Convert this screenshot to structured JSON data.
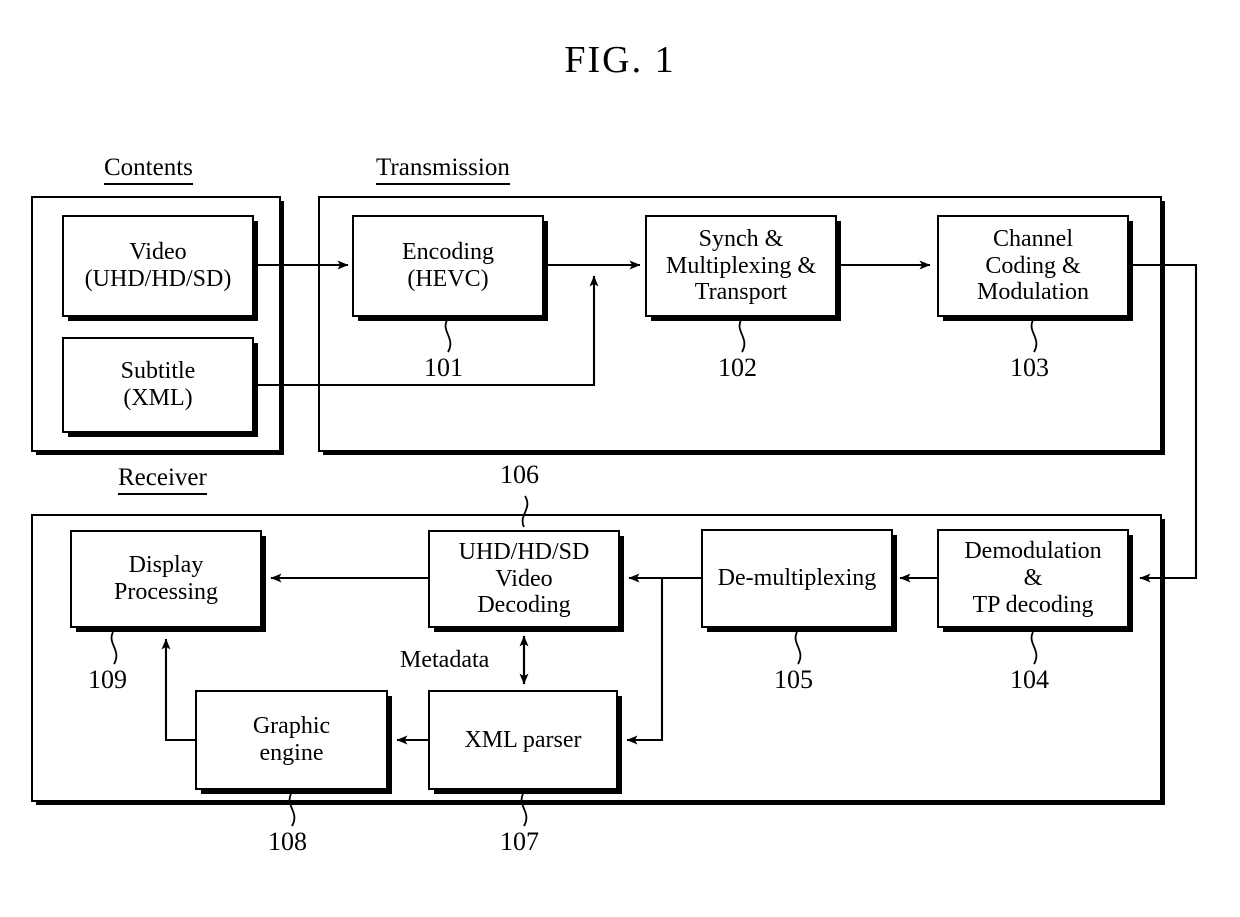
{
  "figure": {
    "title": "FIG. 1"
  },
  "sections": {
    "contents": {
      "caption": "Contents"
    },
    "transmission": {
      "caption": "Transmission"
    },
    "receiver": {
      "caption": "Receiver"
    }
  },
  "blocks": {
    "video_source": {
      "line1": "Video",
      "line2": "(UHD/HD/SD)"
    },
    "subtitle_source": {
      "line1": "Subtitle",
      "line2": "(XML)"
    },
    "encoding": {
      "line1": "Encoding",
      "line2": "(HEVC)",
      "ref": "101"
    },
    "synch_mux": {
      "line1": "Synch &",
      "line2": "Multiplexing &",
      "line3": "Transport",
      "ref": "102"
    },
    "channel_coding": {
      "line1": "Channel",
      "line2": "Coding &",
      "line3": "Modulation",
      "ref": "103"
    },
    "demodulation": {
      "line1": "Demodulation",
      "line2": "&",
      "line3": "TP decoding",
      "ref": "104"
    },
    "demultiplexing": {
      "line1": "De-multiplexing",
      "ref": "105"
    },
    "video_decoding": {
      "line1": "UHD/HD/SD",
      "line2": "Video",
      "line3": "Decoding",
      "ref": "106"
    },
    "xml_parser": {
      "line1": "XML parser",
      "ref": "107"
    },
    "graphic_engine": {
      "line1": "Graphic",
      "line2": "engine",
      "ref": "108"
    },
    "display_processing": {
      "line1": "Display",
      "line2": "Processing",
      "ref": "109"
    }
  },
  "labels": {
    "metadata": "Metadata"
  },
  "colors": {
    "stroke": "#000000",
    "background": "#ffffff"
  }
}
